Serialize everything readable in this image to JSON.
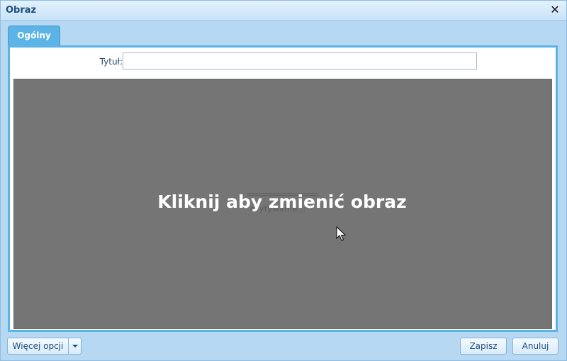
{
  "dialog": {
    "title": "Obraz",
    "close_glyph": "✕",
    "close_icon": "close-icon"
  },
  "tabs": [
    {
      "label": "Ogólny",
      "active": true
    }
  ],
  "form": {
    "title_label": "Tytuł:",
    "title_value": "",
    "title_placeholder": ""
  },
  "image": {
    "overlay_text": "Kliknij aby zmienić obraz",
    "background_text": "czytywanie...",
    "background_color": "#757575"
  },
  "footer": {
    "more_options_label": "Więcej opcji",
    "save_label": "Zapisz",
    "cancel_label": "Anuluj"
  },
  "colors": {
    "accent": "#5bb3e6",
    "dialog_bg": "#b6d8f2",
    "title_text": "#1f4f7a"
  }
}
